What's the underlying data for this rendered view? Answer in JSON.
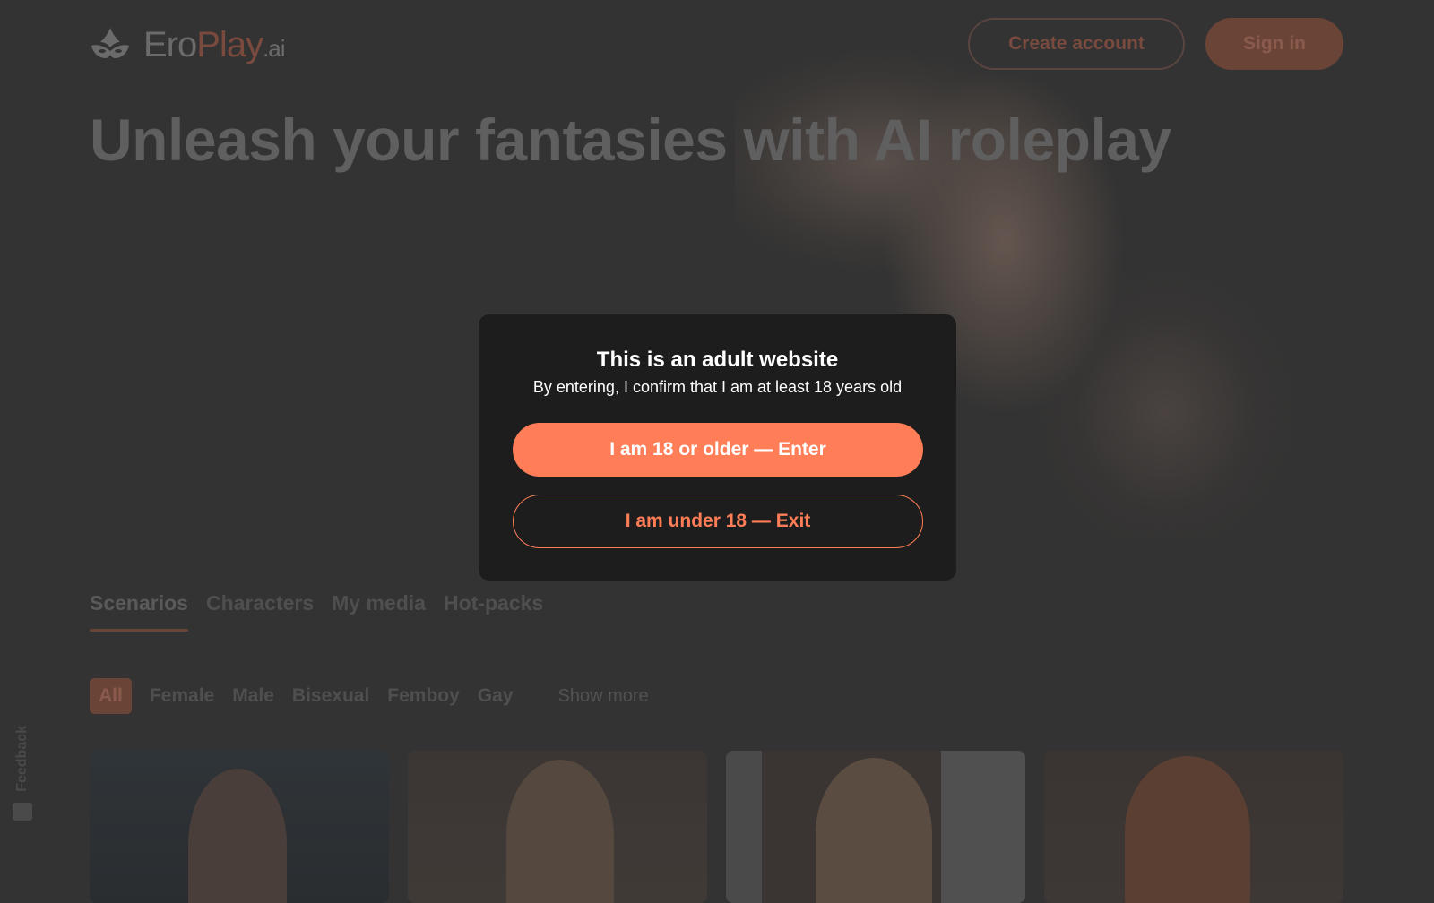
{
  "header": {
    "logo_ero": "Ero",
    "logo_play": "Play",
    "logo_ai": ".ai",
    "create_account": "Create account",
    "sign_in": "Sign in"
  },
  "hero": {
    "title": "Unleash your fantasies with AI roleplay"
  },
  "tabs": [
    {
      "label": "Scenarios",
      "active": true
    },
    {
      "label": "Characters",
      "active": false
    },
    {
      "label": "My media",
      "active": false
    },
    {
      "label": "Hot-packs",
      "active": false
    }
  ],
  "filters": {
    "chips": [
      {
        "label": "All",
        "active": true
      },
      {
        "label": "Female",
        "active": false
      },
      {
        "label": "Male",
        "active": false
      },
      {
        "label": "Bisexual",
        "active": false
      },
      {
        "label": "Femboy",
        "active": false
      },
      {
        "label": "Gay",
        "active": false
      }
    ],
    "show_more": "Show more"
  },
  "feedback": {
    "label": "Feedback",
    "icon": "feedback-icon"
  },
  "modal": {
    "title": "This is an adult website",
    "subtitle": "By entering, I confirm that I am at least 18 years old",
    "enter_label": "I am 18 or older — Enter",
    "exit_label": "I am under 18 — Exit"
  },
  "colors": {
    "accent": "#ff7e57",
    "modal_bg": "#1d1d1d",
    "overlay_bg": "#333333"
  }
}
